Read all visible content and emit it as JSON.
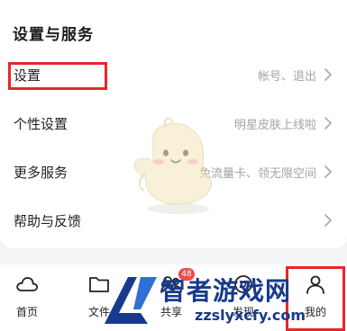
{
  "section": {
    "title": "设置与服务"
  },
  "rows": [
    {
      "label": "设置",
      "hint": "帐号、退出"
    },
    {
      "label": "个性设置",
      "hint": "明星皮肤上线啦"
    },
    {
      "label": "更多服务",
      "hint": "免流量卡、领无限空间"
    },
    {
      "label": "帮助与反馈",
      "hint": ""
    }
  ],
  "nav": {
    "items": [
      {
        "label": "首页",
        "icon": "cloud-icon"
      },
      {
        "label": "文件",
        "icon": "folder-icon"
      },
      {
        "label": "共享",
        "icon": "share-icon",
        "badge": "48"
      },
      {
        "label": "发现",
        "icon": "discover-icon"
      },
      {
        "label": "我的",
        "icon": "profile-icon"
      }
    ]
  },
  "watermark": {
    "title": "智者游戏网",
    "url": "zzslyxcfy.com"
  },
  "colors": {
    "highlight": "#e8262c",
    "badge": "#ef4b4b",
    "watermark": "#173a8c",
    "background": "#f3f4f6"
  }
}
